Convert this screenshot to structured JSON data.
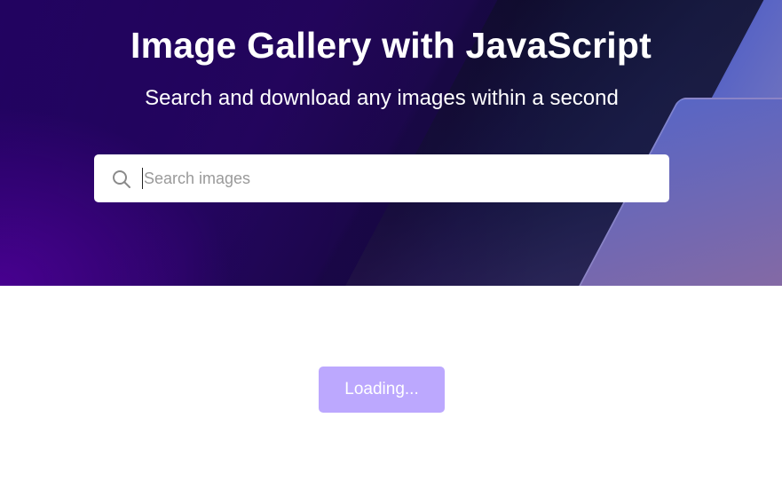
{
  "header": {
    "title": "Image Gallery with JavaScript",
    "subtitle": "Search and download any images within a second"
  },
  "search": {
    "placeholder": "Search images",
    "value": "",
    "icon": "search-icon"
  },
  "gallery": {
    "load_more_label": "Loading...",
    "button_color": "#bca8fe"
  }
}
